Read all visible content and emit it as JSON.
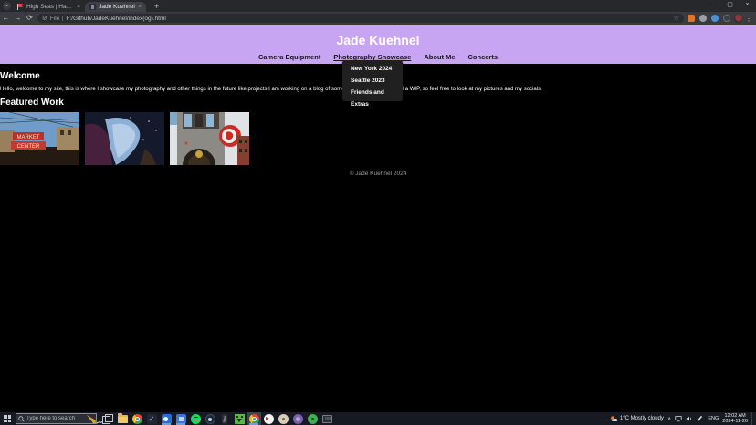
{
  "browser": {
    "tabs": [
      {
        "title": "High Seas | Hack Club"
      },
      {
        "title": "Jade Kuehnel"
      }
    ],
    "toolbar": {
      "address_scheme": "File",
      "address_path": "F:/Github/JadeKuehnel/index(og).html"
    }
  },
  "icons": {
    "tab_search": "⌄",
    "close": "×",
    "new_tab": "+",
    "minimize": "–",
    "maximize": "▢",
    "back": "←",
    "forward": "→",
    "reload": "⟳",
    "file_badge": "⊘",
    "star": "☆",
    "menu_dots": "⋮",
    "check_swoosh": "✓",
    "tray_chevron": "∧"
  },
  "page": {
    "site_title": "Jade Kuehnel",
    "nav": [
      {
        "label": "Camera Equipment"
      },
      {
        "label": "Photography Showcase"
      },
      {
        "label": "About Me"
      },
      {
        "label": "Concerts"
      }
    ],
    "dropdown": [
      {
        "label": "New York 2024"
      },
      {
        "label": "Seattle 2023"
      },
      {
        "label": "Friends and Extras"
      }
    ],
    "welcome_heading": "Welcome",
    "welcome_body": "Hello, welcome to my site, this is where I showcase my photography and other things in the future like projects I am working on a blog of some sort. This website is still a WIP, so feel free to look at my pictures and my socials.",
    "featured_heading": "Featured Work",
    "photos": [
      {
        "alt": "Public Market Center neon sign"
      },
      {
        "alt": "MoPOP building at night"
      },
      {
        "alt": "Firehouse with round red sign"
      }
    ],
    "footer": "© Jade Kuehnel 2024"
  },
  "taskbar": {
    "search_placeholder": "Type here to search",
    "weather": "1°C Mostly cloudy",
    "language": "ENG",
    "time": "12:02 AM",
    "date": "2024-11-26"
  },
  "colors": {
    "accent_purple": "#c8a5f3",
    "page_bg": "#000000",
    "dropdown_bg": "#202020",
    "taskbar_bg": "#171a22"
  }
}
